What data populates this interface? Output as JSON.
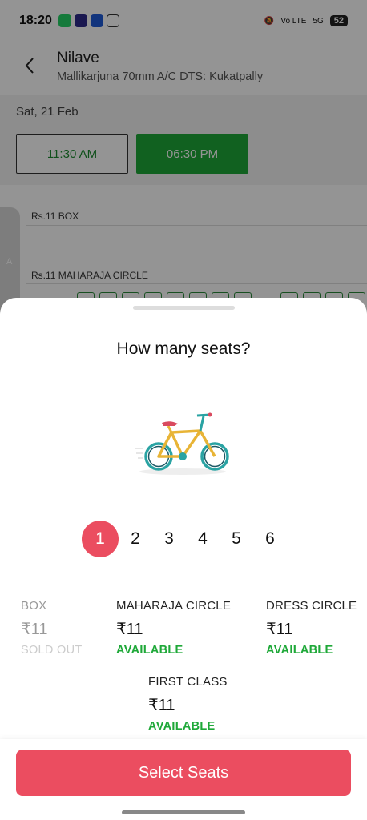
{
  "status_bar": {
    "time": "18:20",
    "apps": [
      "whatsapp-icon",
      "pass-icon",
      "phone-icon",
      "mail-icon"
    ],
    "network_label": "Vo LTE",
    "signal": "5G",
    "battery": "52"
  },
  "header": {
    "title": "Nilave",
    "venue": "Mallikarjuna 70mm A/C DTS: Kukatpally"
  },
  "showtimes": {
    "date": "Sat, 21 Feb",
    "times": [
      "11:30 AM",
      "06:30 PM"
    ],
    "selected": "06:30 PM"
  },
  "seat_layout": {
    "row_letter": "A",
    "categories": [
      "Rs.11  BOX",
      "Rs.11  MAHARAJA CIRCLE"
    ]
  },
  "sheet": {
    "title": "How many seats?",
    "seat_counts": [
      "1",
      "2",
      "3",
      "4",
      "5",
      "6"
    ],
    "selected_count": "1",
    "tiers": [
      {
        "name": "BOX",
        "price": "₹11",
        "status": "SOLD OUT"
      },
      {
        "name": "MAHARAJA CIRCLE",
        "price": "₹11",
        "status": "AVAILABLE"
      },
      {
        "name": "DRESS CIRCLE",
        "price": "₹11",
        "status": "AVAILABLE"
      },
      {
        "name": "FIRST CLASS",
        "price": "₹11",
        "status": "AVAILABLE"
      }
    ],
    "cta": "Select Seats"
  },
  "colors": {
    "accent": "#eb4d60",
    "available": "#1ea838",
    "selected_time": "#1ea838"
  }
}
